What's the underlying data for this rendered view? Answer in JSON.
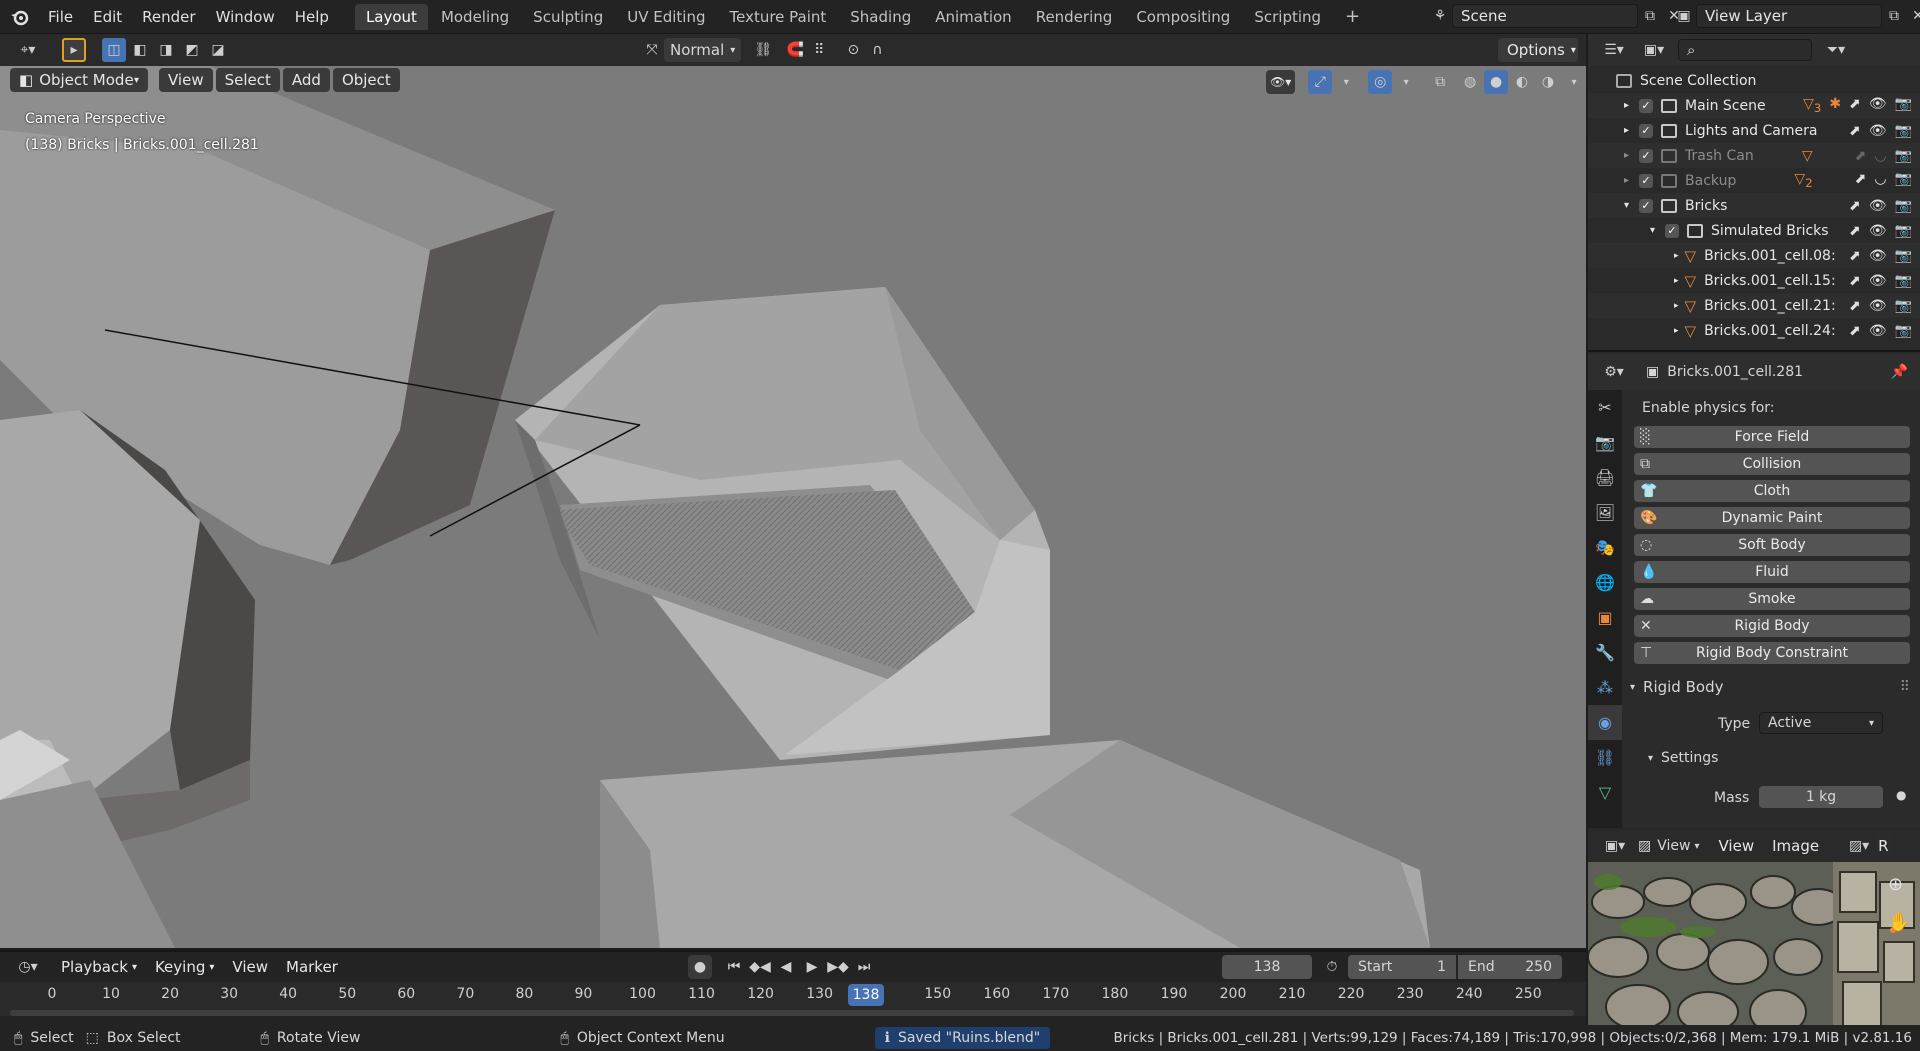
{
  "menu": [
    "File",
    "Edit",
    "Render",
    "Window",
    "Help"
  ],
  "workspaces": [
    "Layout",
    "Modeling",
    "Sculpting",
    "UV Editing",
    "Texture Paint",
    "Shading",
    "Animation",
    "Rendering",
    "Compositing",
    "Scripting"
  ],
  "scene_name": "Scene",
  "view_layer": "View Layer",
  "toolbar": {
    "orientation": "Normal",
    "options": "Options"
  },
  "viewport_header": {
    "mode": "Object Mode",
    "view": "View",
    "select": "Select",
    "add": "Add",
    "object": "Object"
  },
  "viewport_overlay": {
    "line1": "Camera Perspective",
    "line2": "(138) Bricks | Bricks.001_cell.281"
  },
  "outliner": {
    "root": "Scene Collection",
    "rows": [
      {
        "label": "Main Scene",
        "badge": "3"
      },
      {
        "label": "Lights and Camera"
      },
      {
        "label": "Trash Can"
      },
      {
        "label": "Backup",
        "badge": "2"
      },
      {
        "label": "Bricks"
      },
      {
        "label": "Simulated Bricks"
      },
      {
        "label": "Bricks.001_cell.08:"
      },
      {
        "label": "Bricks.001_cell.15:"
      },
      {
        "label": "Bricks.001_cell.21:"
      },
      {
        "label": "Bricks.001_cell.24:"
      }
    ]
  },
  "properties": {
    "object_name": "Bricks.001_cell.281",
    "enable_label": "Enable physics for:",
    "buttons": [
      "Force Field",
      "Collision",
      "Cloth",
      "Dynamic Paint",
      "Soft Body",
      "Fluid",
      "Smoke",
      "Rigid Body",
      "Rigid Body Constraint"
    ],
    "rigid_body_panel": "Rigid Body",
    "type_label": "Type",
    "type_value": "Active",
    "settings_panel": "Settings",
    "mass_label": "Mass",
    "mass_value": "1 kg"
  },
  "image_editor": {
    "view": "View",
    "view2": "View",
    "image": "Image",
    "extra": "R"
  },
  "timeline": {
    "playback": "Playback",
    "keying": "Keying",
    "view": "View",
    "marker": "Marker",
    "current_frame": "138",
    "start_label": "Start",
    "start_value": "1",
    "end_label": "End",
    "end_value": "250",
    "ticks": [
      "0",
      "10",
      "20",
      "30",
      "40",
      "50",
      "60",
      "70",
      "80",
      "90",
      "100",
      "110",
      "120",
      "130",
      "150",
      "160",
      "170",
      "180",
      "190",
      "200",
      "210",
      "220",
      "230",
      "240",
      "250"
    ],
    "playhead_label": "138"
  },
  "statusbar": {
    "select": "Select",
    "box_select": "Box Select",
    "rotate": "Rotate View",
    "context": "Object Context Menu",
    "saved": "Saved \"Ruins.blend\"",
    "stats": "Bricks | Bricks.001_cell.281 | Verts:99,129 | Faces:74,189 | Tris:170,998 | Objects:0/2,368 | Mem: 179.1 MiB | v2.81.16"
  },
  "colors": {
    "accent": "#4772b3",
    "mesh_orange": "#e8883a",
    "viewport_bg": "#7c7c7c"
  }
}
